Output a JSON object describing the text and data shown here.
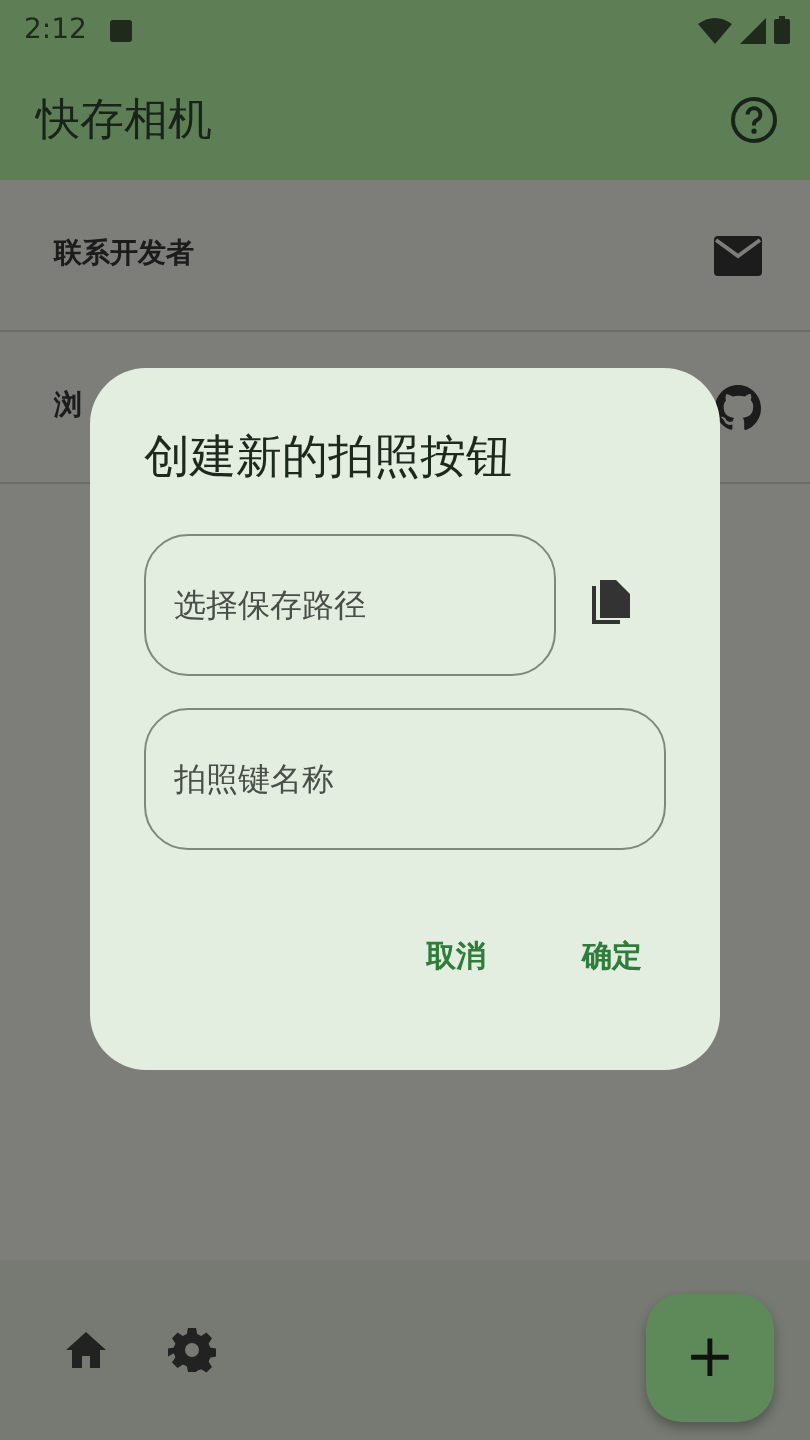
{
  "status_bar": {
    "time": "2:12"
  },
  "app_bar": {
    "title": "快存相机"
  },
  "list": [
    {
      "label": "联系开发者",
      "kind": "mail"
    },
    {
      "label": "浏",
      "kind": "github"
    }
  ],
  "dialog": {
    "title": "创建新的拍照按钮",
    "fields": [
      {
        "placeholder": "选择保存路径",
        "kind": "path"
      },
      {
        "placeholder": "拍照键名称",
        "kind": "plain"
      }
    ],
    "buttons": [
      "取消",
      "确定"
    ]
  },
  "bottom_bar": {
    "items": [
      {
        "kind": "home"
      },
      {
        "kind": "settings"
      }
    ],
    "fab": "+"
  }
}
